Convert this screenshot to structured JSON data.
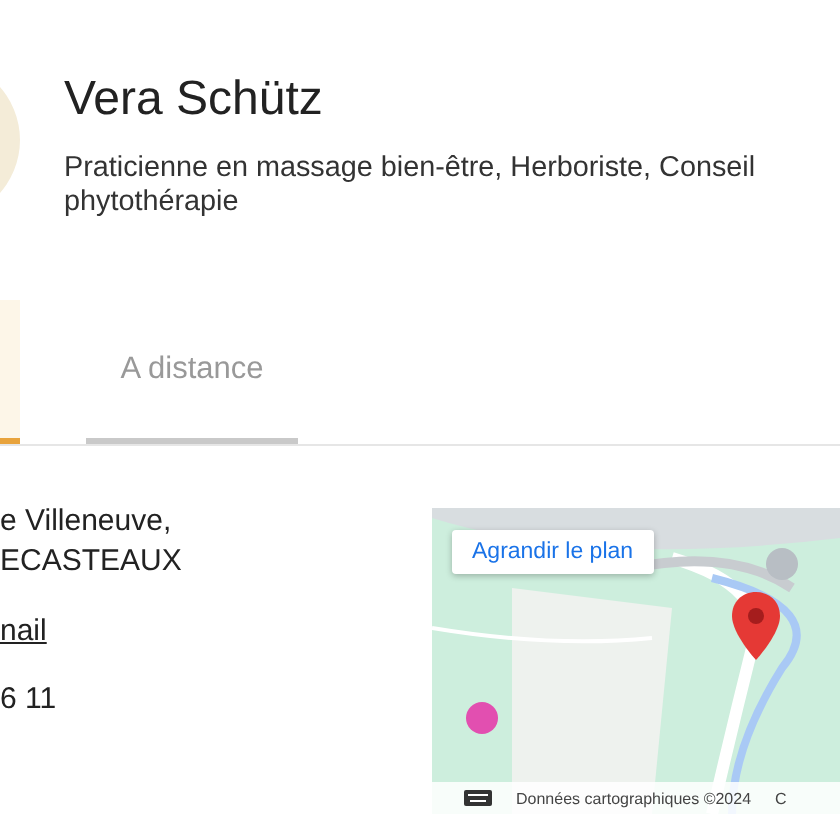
{
  "profile": {
    "name": "Vera Schütz",
    "subtitle": "Praticienne en massage bien-être, Herboriste, Conseil phytothérapie"
  },
  "tabs": [
    {
      "selected": true
    },
    {
      "label": "A distance",
      "selected": false
    }
  ],
  "contact": {
    "address_lines": [
      "e Villeneuve,",
      "ECASTEAUX"
    ],
    "email_link": "nail",
    "phone": "6 11"
  },
  "map": {
    "kind": "picture",
    "enlarge_button": "Agrandir le plan",
    "attribution": "Données cartographiques ©2024",
    "terms_link": "C"
  }
}
